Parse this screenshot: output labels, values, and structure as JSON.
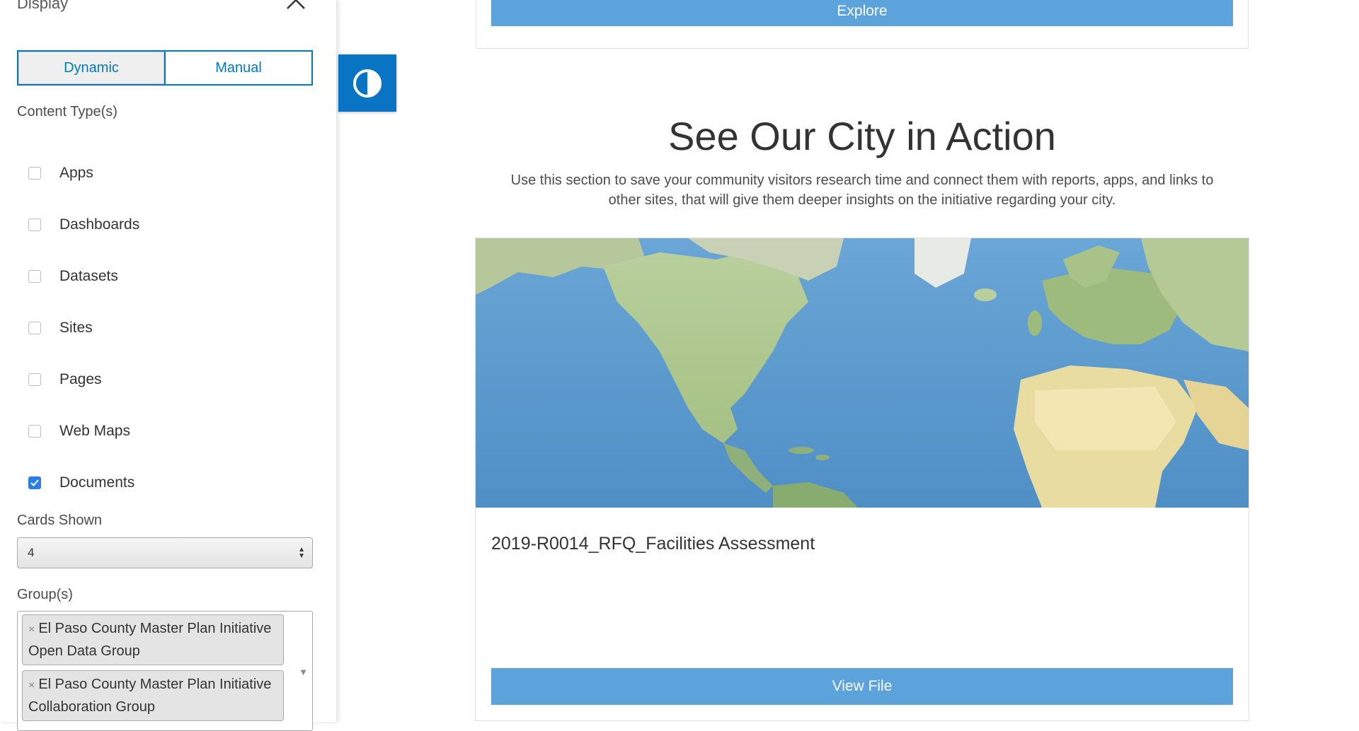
{
  "sidebar": {
    "panel_title": "Display",
    "modes": [
      "Dynamic",
      "Manual"
    ],
    "active_mode": "Dynamic",
    "content_types_label": "Content Type(s)",
    "content_types": [
      {
        "label": "Apps",
        "checked": false
      },
      {
        "label": "Dashboards",
        "checked": false
      },
      {
        "label": "Datasets",
        "checked": false
      },
      {
        "label": "Sites",
        "checked": false
      },
      {
        "label": "Pages",
        "checked": false
      },
      {
        "label": "Web Maps",
        "checked": false
      },
      {
        "label": "Documents",
        "checked": true
      }
    ],
    "cards_shown_label": "Cards Shown",
    "cards_shown_value": "4",
    "groups_label": "Group(s)",
    "groups": [
      {
        "remove": "×",
        "line1": "El Paso County Master Plan Initiative",
        "line2": "Open Data Group"
      },
      {
        "remove": "×",
        "line1": "El Paso County Master Plan Initiative",
        "line2": "Collaboration Group"
      }
    ]
  },
  "main": {
    "explore_label": "Explore",
    "section_title": "See Our City in Action",
    "section_desc_line1": "Use this section to save your community visitors research time and connect them with reports, apps, and links to",
    "section_desc_line2": "other sites, that will give them deeper insights on the initiative regarding your city.",
    "card": {
      "title": "2019-R0014_RFQ_Facilities Assessment",
      "button_label": "View File"
    }
  },
  "icons": {
    "collapse": "chevron-up-icon",
    "contrast": "contrast-icon",
    "check": "check-icon",
    "select_arrows": "updown-arrows-icon",
    "remove": "close-icon",
    "dropdown": "caret-down-icon"
  },
  "colors": {
    "accent": "#0079c1",
    "button": "#5ba3da",
    "contrast_button": "#0a74c4",
    "checkbox_checked": "#2a7ee5"
  }
}
